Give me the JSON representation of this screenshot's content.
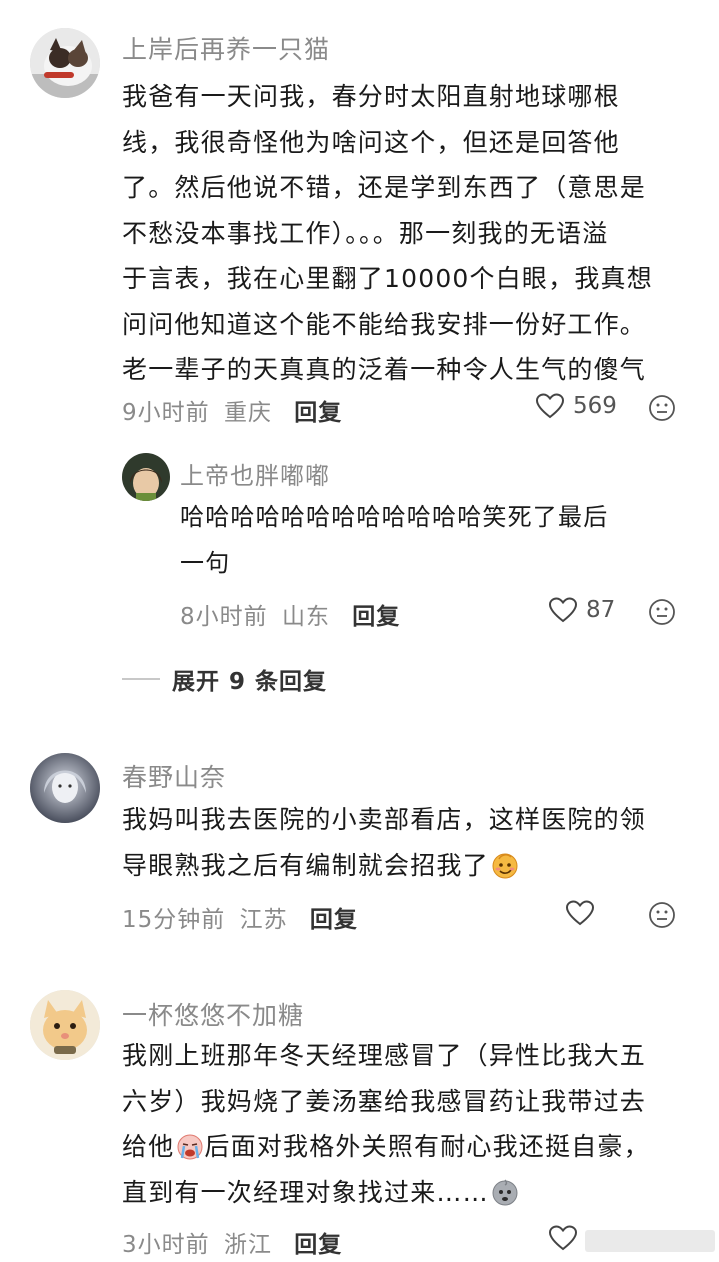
{
  "comments": [
    {
      "username": "上岸后再养一只猫",
      "lines": [
        "我爸有一天问我，春分时太阳直射地球哪根",
        "线，我很奇怪他为啥问这个，但还是回答他",
        "了。然后他说不错，还是学到东西了（意思是",
        "不愁没本事找工作）。。。那一刻我的无语溢",
        "于言表，我在心里翻了10000个白眼，我真想",
        "问问他知道这个能不能给我安排一份好工作。",
        "老一辈子的天真真的泛着一种令人生气的傻气"
      ],
      "time": "9小时前",
      "location": "重庆",
      "reply_label": "回复",
      "likes": "569"
    },
    {
      "username": "上帝也胖嘟嘟",
      "lines": [
        "哈哈哈哈哈哈哈哈哈哈哈哈笑死了最后",
        "一句"
      ],
      "time": "8小时前",
      "location": "山东",
      "reply_label": "回复",
      "likes": "87"
    },
    {
      "username": "春野山奈",
      "lines": [
        "我妈叫我去医院的小卖部看店，这样医院的领",
        "导眼熟我之后有编制就会招我了"
      ],
      "time": "15分钟前",
      "location": "江苏",
      "reply_label": "回复",
      "likes": ""
    },
    {
      "username": "一杯悠悠不加糖",
      "lines": [
        "我刚上班那年冬天经理感冒了（异性比我大五",
        "六岁）我妈烧了姜汤塞给我感冒药让我带过去",
        "给他",
        "后面对我格外关照有耐心我还挺自豪，",
        "直到有一次经理对象找过来……"
      ],
      "time": "3小时前",
      "location": "浙江",
      "reply_label": "回复",
      "likes": ""
    }
  ],
  "expand_replies": "展开 9 条回复",
  "icons": {
    "like": "heart-outline-icon",
    "emoji": "smiley-outline-icon"
  },
  "colors": {
    "text": "#1a1a1a",
    "muted": "#8a8a8a",
    "background": "#ffffff"
  }
}
